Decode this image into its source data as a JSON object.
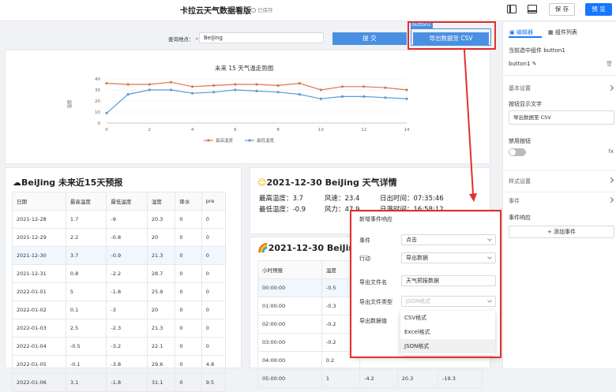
{
  "header": {
    "title": "卡拉云天气数据看版",
    "saved": "已保存",
    "save_label": "保 存",
    "preview_label": "预 览"
  },
  "query": {
    "label": "查询地点：",
    "required": "*",
    "value": "BeiJing",
    "submit_label": "提 交",
    "export_label": "导出数据至 CSV",
    "selected_tag": "button1"
  },
  "chart": {
    "title": "未来 15 天气温走势图",
    "ylabel": "温度"
  },
  "chart_data": {
    "type": "line",
    "title": "未来 15 天气温走势图",
    "ylabel": "温度",
    "x": [
      0,
      1,
      2,
      3,
      4,
      5,
      6,
      7,
      8,
      9,
      10,
      11,
      12,
      13,
      14
    ],
    "xticks": [
      "0",
      "2",
      "4",
      "6",
      "8",
      "10",
      "12",
      "14"
    ],
    "yticks": [
      "0",
      "10",
      "20",
      "30",
      "40"
    ],
    "ylim": [
      0,
      40
    ],
    "series": [
      {
        "name": "最高温度",
        "color": "#d9774f",
        "values": [
          36,
          35,
          35,
          37,
          33,
          34,
          35,
          35,
          34,
          36,
          30,
          33,
          33,
          32,
          30
        ]
      },
      {
        "name": "最低温度",
        "color": "#5b9bd5",
        "values": [
          9,
          26,
          30,
          30,
          27,
          28,
          30,
          29,
          28,
          26,
          22,
          24,
          24,
          23,
          22
        ]
      }
    ]
  },
  "forecast": {
    "title": "BeiJing 未来近15天预报",
    "columns": [
      "日期",
      "最高温度",
      "最低温度",
      "湿度",
      "降水",
      "pre"
    ],
    "rows": [
      [
        "2021-12-28",
        "1.7",
        "-9",
        "20.3",
        "0",
        "0"
      ],
      [
        "2021-12-29",
        "2.2",
        "-0.8",
        "20",
        "0",
        "0"
      ],
      [
        "2021-12-30",
        "3.7",
        "-0.9",
        "21.3",
        "0",
        "0"
      ],
      [
        "2021-12-31",
        "0.8",
        "-2.2",
        "28.7",
        "0",
        "0"
      ],
      [
        "2022-01-01",
        "5",
        "-1.8",
        "25.9",
        "0",
        "0"
      ],
      [
        "2022-01-02",
        "0.1",
        "-3",
        "20",
        "0",
        "0"
      ],
      [
        "2022-01-03",
        "2.5",
        "-2.3",
        "21.3",
        "0",
        "0"
      ],
      [
        "2022-01-04",
        "-0.5",
        "-3.2",
        "22.1",
        "0",
        "0"
      ],
      [
        "2022-01-05",
        "-0.1",
        "-3.8",
        "29.6",
        "0",
        "4.8"
      ],
      [
        "2022-01-06",
        "3.1",
        "-1.8",
        "31.1",
        "0",
        "9.5"
      ]
    ]
  },
  "detail": {
    "title": "2021-12-30 BeiJing 天气详情",
    "max_temp": "最高温度：3.7",
    "min_temp": "最低温度：-0.9",
    "wind_speed": "风速：23.4",
    "wind_power": "风力：47.9",
    "sunrise": "日出时间：07:35:46",
    "sunset": "日落时间：16:58:12"
  },
  "hourly": {
    "title": "2021-12-30 BeiJing",
    "columns": [
      "小时预报",
      "温度"
    ],
    "rows": [
      [
        "00:00:00",
        "-0.5"
      ],
      [
        "01:00:00",
        "-0.3"
      ],
      [
        "02:00:00",
        "-0.2"
      ],
      [
        "03:00:00",
        "-0.2"
      ],
      [
        "04:00:00",
        "0.2"
      ],
      [
        "05:00:00",
        "1",
        "-4.2",
        "20.3",
        "-19.3"
      ]
    ]
  },
  "dialog": {
    "title": "新增事件响应",
    "event_label": "事件",
    "event_value": "点击",
    "action_label": "行动",
    "action_value": "导出数据",
    "filename_label": "导出文件名",
    "filename_value": "天气预报数据",
    "filetype_label": "导出文件类型",
    "filetype_placeholder": "JSON格式",
    "data_label": "导出数据值",
    "options": [
      "CSV格式",
      "Excel格式",
      "JSON格式"
    ]
  },
  "panel": {
    "tab_editor": "编辑器",
    "tab_components": "组件列表",
    "current": "当前选中组件 button1",
    "component_name": "button1",
    "basic_settings": "基本设置",
    "btn_text_label": "按钮显示文字",
    "btn_text_value": "导出数据至 CSV",
    "disabled_label": "禁用按钮",
    "fx": "fx",
    "style_settings": "样式设置",
    "events": "事件",
    "event_response": "事件响应",
    "add_event": "+ 添加事件"
  }
}
